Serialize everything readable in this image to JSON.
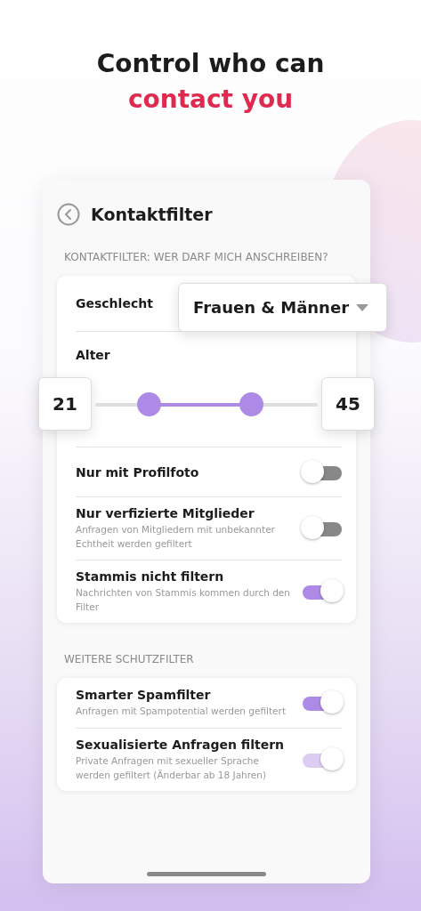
{
  "headline": {
    "line1": "Control who can",
    "line2": "contact you"
  },
  "screen": {
    "title": "Kontaktfilter",
    "section1": {
      "heading": "KONTAKTFILTER: WER DARF MICH ANSCHREIBEN?",
      "gender": {
        "label": "Geschlecht",
        "value": "Frauen & Männer"
      },
      "age": {
        "label": "Alter",
        "min": "21",
        "max": "45",
        "thumbs": [
          {
            "level": 0.24
          },
          {
            "level": 0.7
          }
        ]
      },
      "toggles": [
        {
          "title": "Nur mit Profilfoto",
          "on": false,
          "disabled": false
        },
        {
          "title": "Nur verfizierte Mitglieder",
          "subtitle": "Anfragen von Mitgliedern mit unbekannter Echtheit werden gefiltert",
          "on": false,
          "disabled": false
        },
        {
          "title": "Stammis nicht filtern",
          "subtitle": "Nachrichten von Stammis kommen durch den Filter",
          "on": true,
          "disabled": false
        }
      ]
    },
    "section2": {
      "heading": "WEITERE SCHUTZFILTER",
      "toggles": [
        {
          "title": "Smarter Spamfilter",
          "subtitle": "Anfragen mit Spampotential werden gefiltert",
          "on": true,
          "disabled": false
        },
        {
          "title": "Sexualisierte Anfragen filtern",
          "subtitle": "Private Anfragen mit sexueller Sprache werden gefiltert (Änderbar ab 18 Jahren)",
          "on": true,
          "disabled": true
        }
      ]
    }
  }
}
